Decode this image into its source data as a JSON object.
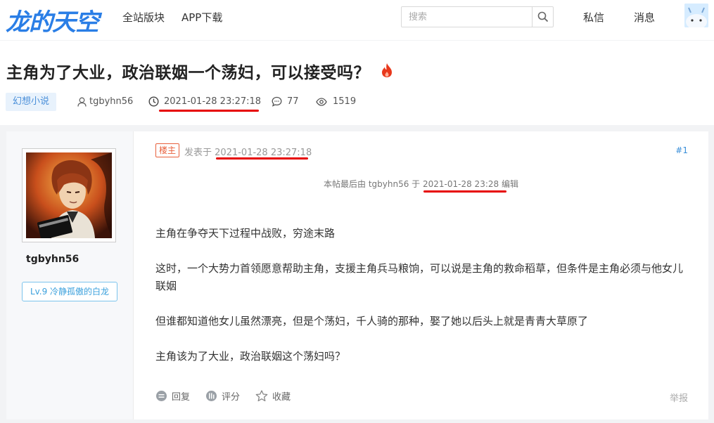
{
  "header": {
    "logo_text": "龙的天空",
    "nav": [
      "全站版块",
      "APP下载"
    ],
    "search_placeholder": "搜索",
    "messages_label": "私信",
    "notifications_label": "消息"
  },
  "thread": {
    "title": "主角为了大业，政治联姻一个荡妇，可以接受吗？",
    "category": "幻想小说",
    "author": "tgbyhn56",
    "created_at": "2021-01-28 23:27:18",
    "reply_count": "77",
    "view_count": "1519"
  },
  "post": {
    "owner_badge": "楼主",
    "posted_prefix": "发表于",
    "posted_at": "2021-01-28 23:27:18",
    "floor": "#1",
    "edit_note_prefix": "本帖最后由 tgbyhn56 于",
    "edit_time": "2021-01-28 23:28",
    "edit_note_suffix": "编辑",
    "paragraphs": [
      "主角在争夺天下过程中战败，穷途末路",
      "这时，一个大势力首领愿意帮助主角，支援主角兵马粮饷，可以说是主角的救命稻草，但条件是主角必须与他女儿联姻",
      "但谁都知道他女儿虽然漂亮，但是个荡妇，千人骑的那种，娶了她以后头上就是青青大草原了",
      "主角该为了大业，政治联姻这个荡妇吗？"
    ],
    "actions": {
      "reply": "回复",
      "rate": "评分",
      "favorite": "收藏"
    },
    "report": "举报"
  },
  "author_panel": {
    "name": "tgbyhn56",
    "level": "Lv.9 冷静孤傲的白龙"
  },
  "colors": {
    "accent": "#2a7ee6",
    "annotation": "#e60000"
  }
}
